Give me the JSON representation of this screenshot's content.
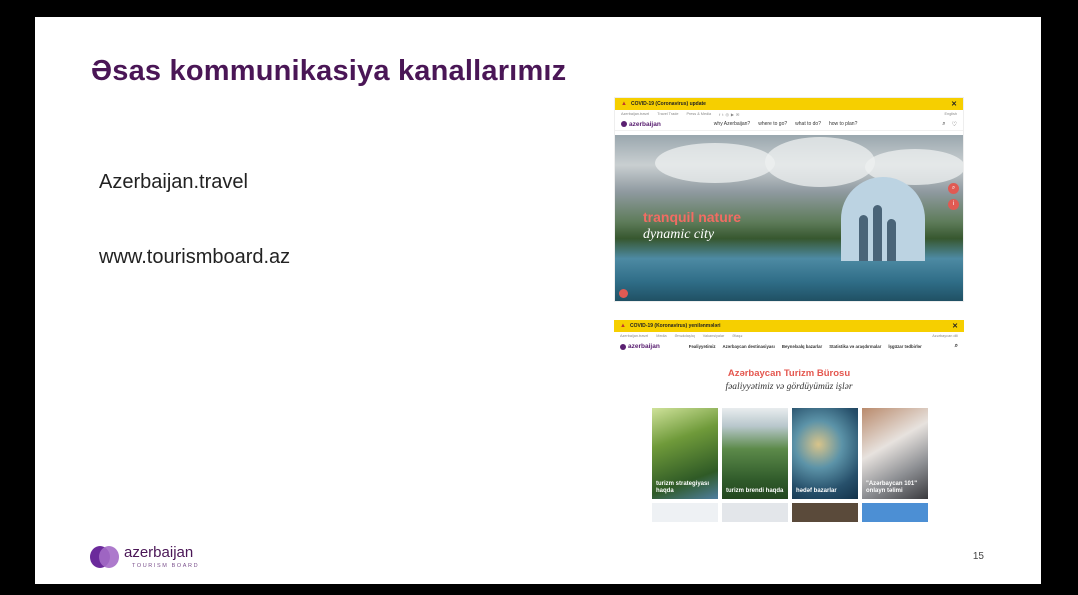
{
  "slide": {
    "title": "Əsas kommunikasiya kanallarımız",
    "links": [
      "Azerbaijan.travel",
      "www.tourismboard.az"
    ],
    "page_number": "15",
    "footer_brand": "azerbaijan",
    "footer_sub": "TOURISM BOARD"
  },
  "shot1": {
    "banner": "COVID-19 (Coronavirus) update",
    "top_links": [
      "Azerbaijan.travel",
      "Travel Trade",
      "Press & Media"
    ],
    "lang": "English",
    "brand": "azerbaijan",
    "nav": [
      "why Azerbaijan?",
      "where to go?",
      "what to do?",
      "how to plan?"
    ],
    "hero_line1": "tranquil nature",
    "hero_line2": "dynamic city"
  },
  "shot2": {
    "banner": "COVID-19 (Koronavirus) yenilənmələri",
    "top_links": [
      "Azerbaijan.travel",
      "Media",
      "Əməkdaşlıq",
      "Vakansiyalar",
      "Əlaqə"
    ],
    "lang": "Azərbaycan dili",
    "brand": "azerbaijan",
    "brand_sub": "TOURISM BOARD",
    "nav": [
      "Fəaliyyətimiz",
      "Azərbaycan destinasiyası",
      "Beynəlxalq bazarlar",
      "Statistika və araşdırmalar",
      "İşgüzar tədbirlər"
    ],
    "heading": "Azərbaycan Turizm Bürosu",
    "subheading": "fəaliyyətimiz və gördüyümüz işlər",
    "tiles": [
      {
        "caption": "turizm strategiyası haqda"
      },
      {
        "caption": "turizm brendi haqda"
      },
      {
        "caption": "hədəf bazarlar"
      },
      {
        "caption": "\"Azərbaycan 101\" onlayn təlimi"
      }
    ]
  },
  "colors": {
    "title": "#4a1656",
    "accent": "#e4574f",
    "banner": "#f6cf00"
  }
}
